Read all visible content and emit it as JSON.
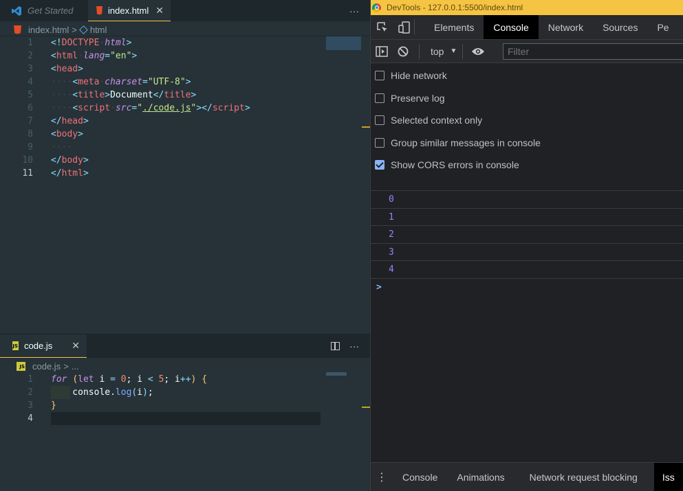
{
  "editor": {
    "top_tabs": [
      {
        "label": "Get Started",
        "icon": "vscode-icon",
        "active": false
      },
      {
        "label": "index.html",
        "icon": "html5-icon",
        "active": true
      }
    ],
    "top_more": "···",
    "top_breadcrumb": {
      "file": "index.html",
      "separator": ">",
      "symbol": "html"
    },
    "html_lines": [
      {
        "n": "1"
      },
      {
        "n": "2"
      },
      {
        "n": "3"
      },
      {
        "n": "4"
      },
      {
        "n": "5"
      },
      {
        "n": "6"
      },
      {
        "n": "7"
      },
      {
        "n": "8"
      },
      {
        "n": "9"
      },
      {
        "n": "10"
      },
      {
        "n": "11"
      }
    ],
    "bottom_tab": {
      "label": "code.js",
      "icon": "js-icon"
    },
    "bottom_close": "✕",
    "bottom_more": "···",
    "bottom_breadcrumb": {
      "file": "code.js",
      "separator": ">",
      "symbol": "..."
    },
    "js_lines": [
      {
        "n": "1"
      },
      {
        "n": "2"
      },
      {
        "n": "3"
      },
      {
        "n": "4"
      }
    ]
  },
  "devtools": {
    "title": "DevTools - 127.0.0.1:5500/index.html",
    "tabs": [
      "Elements",
      "Console",
      "Network",
      "Sources",
      "Pe"
    ],
    "active_tab": "Console",
    "context": "top",
    "filter_placeholder": "Filter",
    "settings": [
      {
        "label": "Hide network",
        "checked": false
      },
      {
        "label": "Preserve log",
        "checked": false
      },
      {
        "label": "Selected context only",
        "checked": false
      },
      {
        "label": "Group similar messages in console",
        "checked": false
      },
      {
        "label": "Show CORS errors in console",
        "checked": true
      }
    ],
    "logs": [
      "0",
      "1",
      "2",
      "3",
      "4"
    ],
    "prompt": ">",
    "drawer_tabs": [
      "Console",
      "Animations",
      "Network request blocking",
      "Iss"
    ],
    "drawer_menu": "⋮"
  },
  "colors": {
    "accent": "#f6c443",
    "console_number": "#9980ff",
    "checkbox": "#8ab4f8"
  }
}
